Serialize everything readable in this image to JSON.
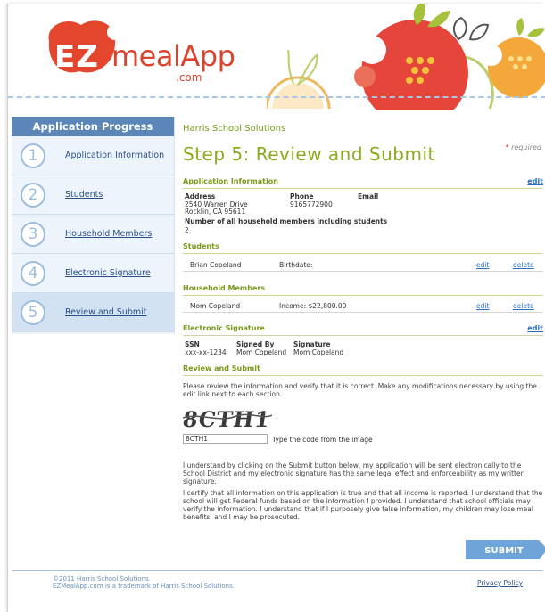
{
  "logo": {
    "ez": "EZ",
    "meal": "mealApp",
    "com": ".com"
  },
  "sidebar": {
    "title": "Application Progress",
    "steps": [
      {
        "num": "1",
        "label": "Application Information"
      },
      {
        "num": "2",
        "label": "Students"
      },
      {
        "num": "3",
        "label": "Household Members"
      },
      {
        "num": "4",
        "label": "Electronic Signature"
      },
      {
        "num": "5",
        "label": "Review and Submit"
      }
    ]
  },
  "main": {
    "org": "Harris School Solutions",
    "title": "Step 5: Review and Submit",
    "required_star": "*",
    "required_label": "required",
    "edit_label": "edit",
    "delete_label": "delete",
    "app_info": {
      "heading": "Application Information",
      "address_label": "Address",
      "address_line1": "2540 Warren Drive",
      "address_line2": "Rocklin, CA  95611",
      "phone_label": "Phone",
      "phone": "9165772900",
      "email_label": "Email",
      "members_label": "Number of all household members including students",
      "members_count": "2"
    },
    "students": {
      "heading": "Students",
      "rows": [
        {
          "name": "Brian Copeland",
          "detail": "Birthdate:"
        }
      ]
    },
    "household": {
      "heading": "Household Members",
      "rows": [
        {
          "name": "Mom Copeland",
          "detail": "Income: $22,800.00"
        }
      ]
    },
    "esign": {
      "heading": "Electronic Signature",
      "ssn_label": "SSN",
      "signed_by_label": "Signed By",
      "signature_label": "Signature",
      "ssn": "xxx-xx-1234",
      "signed_by": "Mom Copeland",
      "signature": "Mom Copeland"
    },
    "review": {
      "heading": "Review and Submit",
      "instructions": "Please review the information and verify that it is correct. Make any modifications necessary by using the edit link next to each section.",
      "captcha_text": "8CTH1",
      "captcha_input_value": "8CTH1",
      "captcha_hint": "Type the code from the image",
      "para1": "I understand by clicking on the Submit button below, my application will be sent electronically to the School District and my electronic signature has the same legal effect and enforceability as my written signature.",
      "para2": "I certify that all information on this application is true and that all income is reported. I understand that the school will get Federal funds based on the information I provided. I understand that school officials may verify the information. I understand that if I purposely give false information, my children may lose meal benefits, and I may be prosecuted.",
      "submit_label": "SUBMIT"
    }
  },
  "footer": {
    "copyright_line1": "©2011 Harris School Solutions.",
    "copyright_line2": "EZMealApp.com is a trademark of Harris School Solutions.",
    "privacy_label": "Privacy Policy"
  },
  "colors": {
    "accent_green": "#8aab1e",
    "sidebar_blue": "#5b86b7",
    "link_blue": "#2a6fc2",
    "logo_red": "#d9442e"
  },
  "icons": [
    "logo-apple-icon",
    "header-fruit-illustration",
    "step-number-circle-icon",
    "submit-arrow-button"
  ]
}
